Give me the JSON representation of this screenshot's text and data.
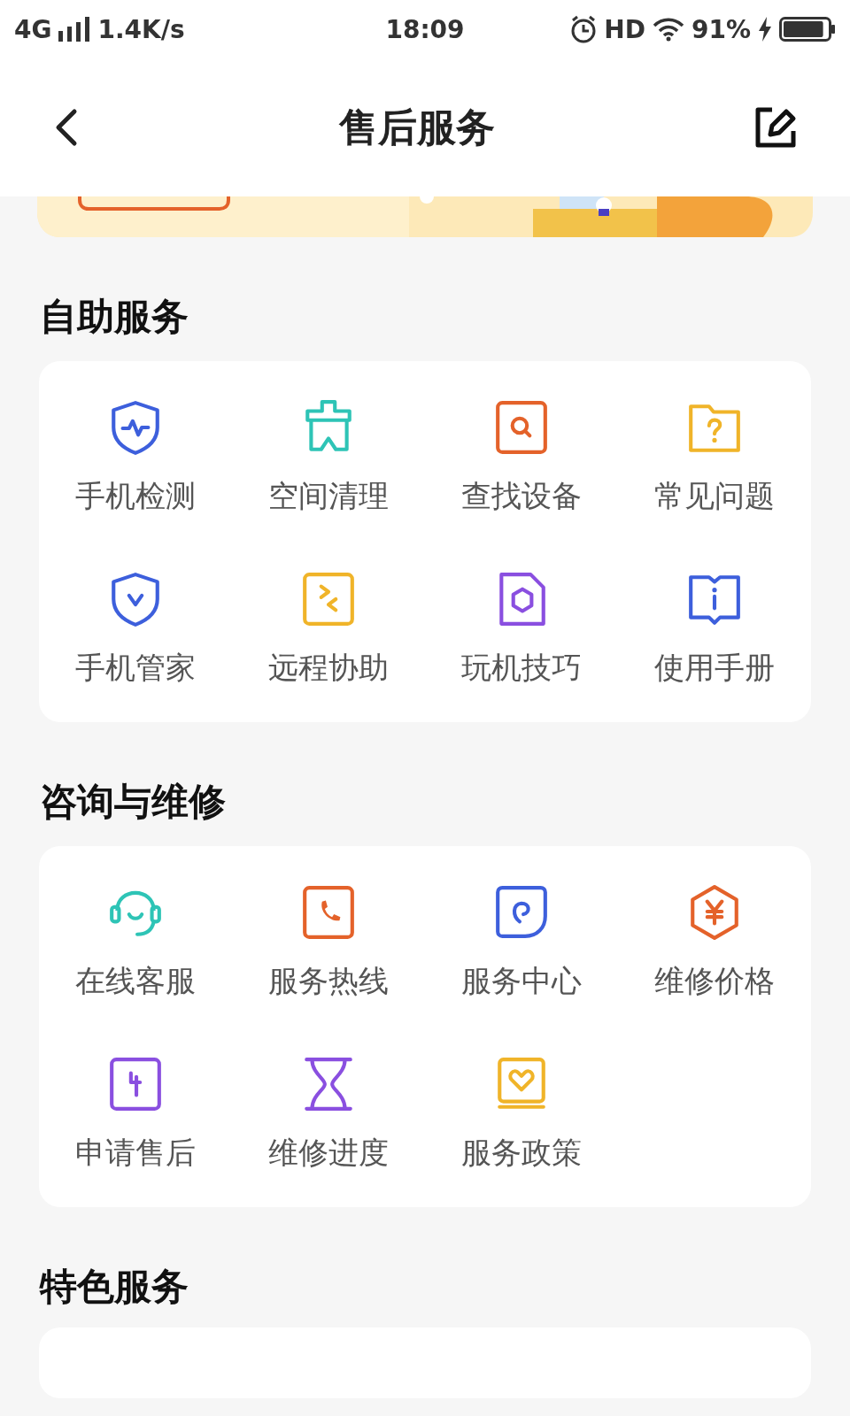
{
  "status_bar": {
    "network": "4G",
    "speed": "1.4K/s",
    "time": "18:09",
    "hd": "HD",
    "battery": "91%"
  },
  "header": {
    "title": "售后服务"
  },
  "sections": [
    {
      "title": "自助服务",
      "items": [
        {
          "label": "手机检测",
          "color": "#3d5fdc"
        },
        {
          "label": "空间清理",
          "color": "#2ec4b6"
        },
        {
          "label": "查找设备",
          "color": "#e4622a"
        },
        {
          "label": "常见问题",
          "color": "#f0b429"
        },
        {
          "label": "手机管家",
          "color": "#3d5fdc"
        },
        {
          "label": "远程协助",
          "color": "#f0b429"
        },
        {
          "label": "玩机技巧",
          "color": "#8a4fe0"
        },
        {
          "label": "使用手册",
          "color": "#3d5fdc"
        }
      ]
    },
    {
      "title": "咨询与维修",
      "items": [
        {
          "label": "在线客服",
          "color": "#2ec4b6"
        },
        {
          "label": "服务热线",
          "color": "#e4622a"
        },
        {
          "label": "服务中心",
          "color": "#3d5fdc"
        },
        {
          "label": "维修价格",
          "color": "#e4622a"
        },
        {
          "label": "申请售后",
          "color": "#8a4fe0"
        },
        {
          "label": "维修进度",
          "color": "#8a4fe0"
        },
        {
          "label": "服务政策",
          "color": "#f0b429"
        }
      ]
    },
    {
      "title": "特色服务"
    }
  ]
}
